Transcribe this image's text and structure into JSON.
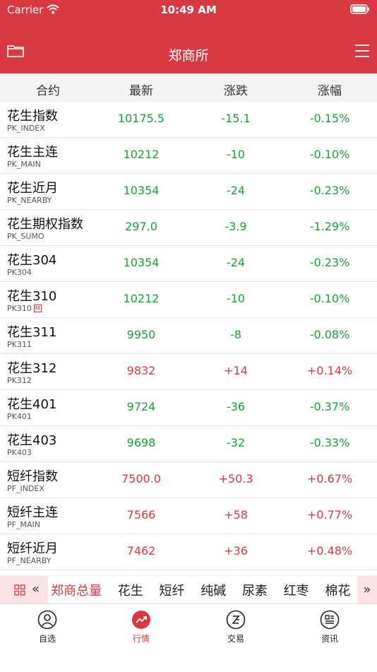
{
  "status": {
    "carrier": "Carrier",
    "time": "10:49 AM"
  },
  "nav": {
    "title": "郑商所"
  },
  "columns": {
    "contract": "合约",
    "latest": "最新",
    "change": "涨跌",
    "change_pct": "涨幅"
  },
  "rows": [
    {
      "name": "花生指数",
      "code": "PK_INDEX",
      "latest": "10175.5",
      "change": "-15.1",
      "pct": "-0.15%",
      "dir": "down"
    },
    {
      "name": "花生主连",
      "code": "PK_MAIN",
      "latest": "10212",
      "change": "-10",
      "pct": "-0.10%",
      "dir": "down"
    },
    {
      "name": "花生近月",
      "code": "PK_NEARBY",
      "latest": "10354",
      "change": "-24",
      "pct": "-0.23%",
      "dir": "down"
    },
    {
      "name": "花生期权指数",
      "code": "PK_SUMO",
      "latest": "297.0",
      "change": "-3.9",
      "pct": "-1.29%",
      "dir": "down"
    },
    {
      "name": "花生304",
      "code": "PK304",
      "latest": "10354",
      "change": "-24",
      "pct": "-0.23%",
      "dir": "down"
    },
    {
      "name": "花生310",
      "code": "PK310",
      "badge": "M",
      "latest": "10212",
      "change": "-10",
      "pct": "-0.10%",
      "dir": "down"
    },
    {
      "name": "花生311",
      "code": "PK311",
      "latest": "9950",
      "change": "-8",
      "pct": "-0.08%",
      "dir": "down"
    },
    {
      "name": "花生312",
      "code": "PK312",
      "latest": "9832",
      "change": "+14",
      "pct": "+0.14%",
      "dir": "up"
    },
    {
      "name": "花生401",
      "code": "PK401",
      "latest": "9724",
      "change": "-36",
      "pct": "-0.37%",
      "dir": "down"
    },
    {
      "name": "花生403",
      "code": "PK403",
      "latest": "9698",
      "change": "-32",
      "pct": "-0.33%",
      "dir": "down"
    },
    {
      "name": "短纤指数",
      "code": "PF_INDEX",
      "latest": "7500.0",
      "change": "+50.3",
      "pct": "+0.67%",
      "dir": "up"
    },
    {
      "name": "短纤主连",
      "code": "PF_MAIN",
      "latest": "7566",
      "change": "+58",
      "pct": "+0.77%",
      "dir": "up"
    },
    {
      "name": "短纤近月",
      "code": "PF_NEARBY",
      "latest": "7462",
      "change": "+36",
      "pct": "+0.48%",
      "dir": "up"
    }
  ],
  "category_tabs": {
    "left_arrow": "«",
    "right_arrow": "»",
    "items": [
      "郑商总量",
      "花生",
      "短纤",
      "纯碱",
      "尿素",
      "红枣",
      "棉花"
    ],
    "active_index": 0
  },
  "bottom_tabs": [
    {
      "label": "自选",
      "icon": "person-icon"
    },
    {
      "label": "行情",
      "icon": "trend-icon",
      "active": true
    },
    {
      "label": "交易",
      "icon": "exchange-icon"
    },
    {
      "label": "资讯",
      "icon": "news-icon"
    }
  ],
  "colors": {
    "brand_red": "#d83a44",
    "up": "#d83a44",
    "down": "#1aa336"
  }
}
